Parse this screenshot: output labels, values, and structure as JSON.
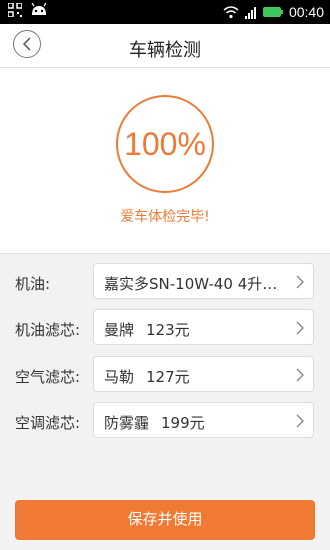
{
  "statusbar": {
    "time": "00:40",
    "icons": [
      "qr-icon",
      "android-icon",
      "wifi-icon",
      "signal-icon",
      "battery-icon"
    ]
  },
  "header": {
    "title": "车辆检测",
    "back_icon": "chevron-left-icon"
  },
  "result": {
    "progress": "100%",
    "progress_value": 1.0,
    "status": "爱车体检完毕!",
    "accent_color": "#f07a33"
  },
  "items": [
    {
      "label": "机油:",
      "value": "嘉实多SN-10W-40 4升…",
      "price": ""
    },
    {
      "label": "机油滤芯:",
      "value": "曼牌",
      "price": "123元"
    },
    {
      "label": "空气滤芯:",
      "value": "马勒",
      "price": "127元"
    },
    {
      "label": "空调滤芯:",
      "value": "防雾霾",
      "price": "199元"
    }
  ],
  "actions": {
    "save_label": "保存并使用"
  }
}
